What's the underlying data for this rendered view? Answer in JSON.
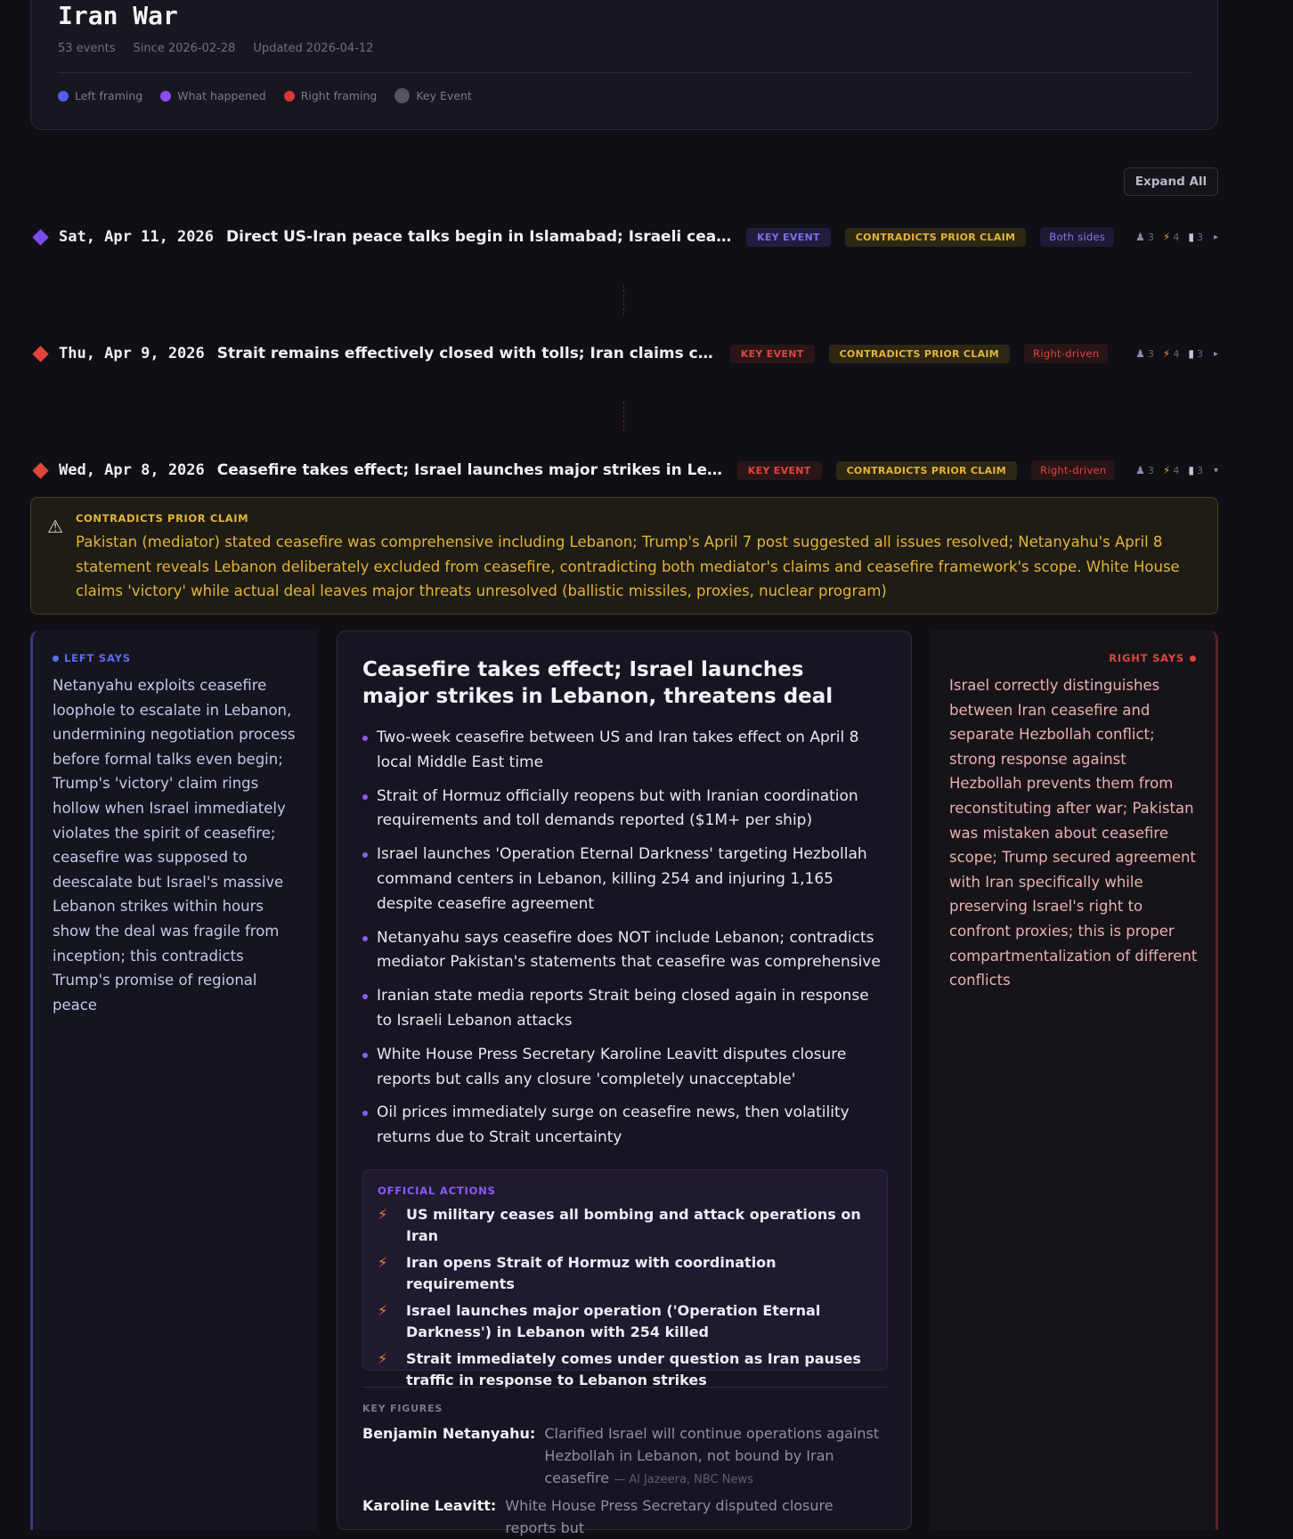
{
  "header": {
    "title": "Iran War",
    "events_count": "53 events",
    "since": "Since 2026-02-28",
    "updated": "Updated 2026-04-12",
    "legend": [
      {
        "label": "Left framing",
        "color": "#4f5ee8"
      },
      {
        "label": "What happened",
        "color": "#8a4cf0"
      },
      {
        "label": "Right framing",
        "color": "#d8383a"
      },
      {
        "label": "Key Event",
        "color": "#55555f"
      }
    ]
  },
  "toolbar": {
    "expand_all": "Expand All"
  },
  "events": [
    {
      "date": "Sat, Apr 11, 2026",
      "title": "Direct US-Iran peace talks begin in Islamabad; Israeli ceasefire violations",
      "key_badge": "KEY EVENT",
      "contradict_badge": "CONTRADICTS PRIOR CLAIM",
      "side_badge": "Both sides",
      "people": "3",
      "actions": "4",
      "sources": "3",
      "color": "#7a4cf0"
    },
    {
      "date": "Thu, Apr 9, 2026",
      "title": "Strait remains effectively closed with tolls; Iran claims control, contested",
      "key_badge": "KEY EVENT",
      "contradict_badge": "CONTRADICTS PRIOR CLAIM",
      "side_badge": "Right-driven",
      "people": "3",
      "actions": "4",
      "sources": "3",
      "color": "#e0453c"
    },
    {
      "date": "Wed, Apr 8, 2026",
      "title": "Ceasefire takes effect; Israel launches major strikes in Lebanon, threatens deal",
      "key_badge": "KEY EVENT",
      "contradict_badge": "CONTRADICTS PRIOR CLAIM",
      "side_badge": "Right-driven",
      "people": "3",
      "actions": "4",
      "sources": "3",
      "color": "#e0453c"
    }
  ],
  "contradiction": {
    "label": "CONTRADICTS PRIOR CLAIM",
    "text": "Pakistan (mediator) stated ceasefire was comprehensive including Lebanon; Trump's April 7 post suggested all issues resolved; Netanyahu's April 8 statement reveals Lebanon deliberately excluded from ceasefire, contradicting both mediator's claims and ceasefire framework's scope. White House claims 'victory' while actual deal leaves major threats unresolved (ballistic missiles, proxies, nuclear program)"
  },
  "left": {
    "label": "LEFT SAYS",
    "text": "Netanyahu exploits ceasefire loophole to escalate in Lebanon, undermining negotiation process before formal talks even begin; Trump's 'victory' claim rings hollow when Israel immediately violates the spirit of ceasefire; ceasefire was supposed to deescalate but Israel's massive Lebanon strikes within hours show the deal was fragile from inception; this contradicts Trump's promise of regional peace"
  },
  "center": {
    "title": "Ceasefire takes effect; Israel launches major strikes in Lebanon, threatens deal",
    "bullets": [
      "Two-week ceasefire between US and Iran takes effect on April 8 local Middle East time",
      "Strait of Hormuz officially reopens but with Iranian coordination requirements and toll demands reported ($1M+ per ship)",
      "Israel launches 'Operation Eternal Darkness' targeting Hezbollah command centers in Lebanon, killing 254 and injuring 1,165 despite ceasefire agreement",
      "Netanyahu says ceasefire does NOT include Lebanon; contradicts mediator Pakistan's statements that ceasefire was comprehensive",
      "Iranian state media reports Strait being closed again in response to Israeli Lebanon attacks",
      "White House Press Secretary Karoline Leavitt disputes closure reports but calls any closure 'completely unacceptable'",
      "Oil prices immediately surge on ceasefire news, then volatility returns due to Strait uncertainty"
    ],
    "actions_label": "OFFICIAL ACTIONS",
    "actions": [
      "US military ceases all bombing and attack operations on Iran",
      "Iran opens Strait of Hormuz with coordination requirements",
      "Israel launches major operation ('Operation Eternal Darkness') in Lebanon with 254 killed",
      "Strait immediately comes under question as Iran pauses traffic in response to Lebanon strikes"
    ],
    "key_figures_label": "KEY FIGURES",
    "figures": [
      {
        "name": "Benjamin Netanyahu:",
        "text": "Clarified Israel will continue operations against Hezbollah in Lebanon, not bound by Iran ceasefire",
        "source": "— Al Jazeera, NBC News"
      },
      {
        "name": "Karoline Leavitt:",
        "text": "White House Press Secretary disputed closure reports but",
        "source": ""
      }
    ]
  },
  "right": {
    "label": "RIGHT SAYS",
    "text": "Israel correctly distinguishes between Iran ceasefire and separate Hezbollah conflict; strong response against Hezbollah prevents them from reconstituting after war; Pakistan was mistaken about ceasefire scope; Trump secured agreement with Iran specifically while preserving Israel's right to confront proxies; this is proper compartmentalization of different conflicts"
  }
}
